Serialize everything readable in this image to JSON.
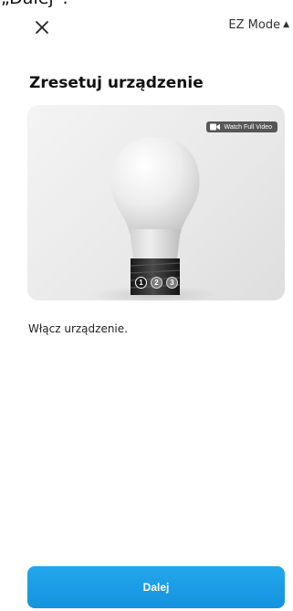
{
  "top_crop_text": "„Dalej”.",
  "header": {
    "close_icon": "close-icon",
    "mode_label": "EZ Mode",
    "mode_icon": "caret-swap-icon"
  },
  "title": "Zresetuj urządzenie",
  "video": {
    "watch_label": "Watch Full Video",
    "watch_icon": "video-camera-icon",
    "steps": [
      {
        "number": "1",
        "active": true
      },
      {
        "number": "2",
        "active": false
      },
      {
        "number": "3",
        "active": false
      }
    ]
  },
  "instruction": "Włącz urządzenie.",
  "next_button": "Dalej",
  "colors": {
    "accent": "#1a9de6",
    "text": "#111111",
    "background": "#ffffff"
  }
}
